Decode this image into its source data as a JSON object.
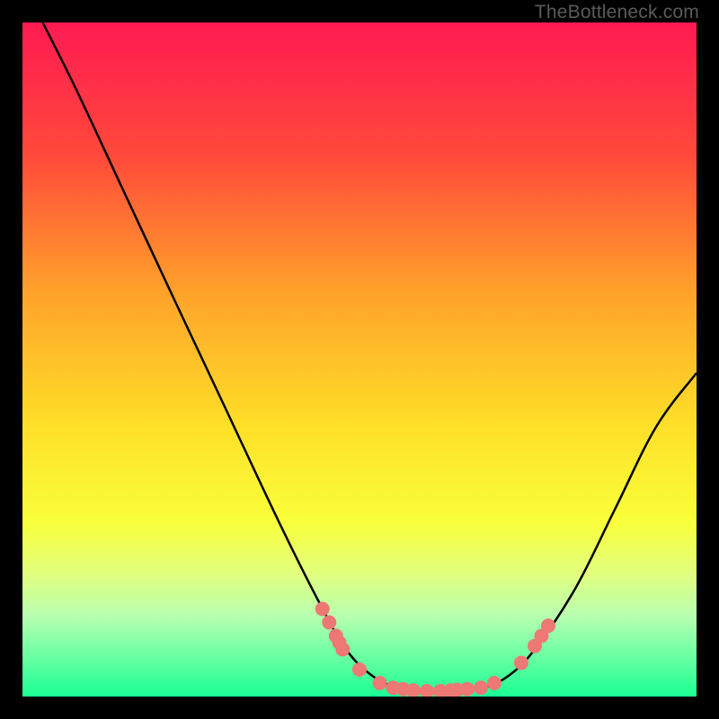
{
  "attribution": "TheBottleneck.com",
  "chart_data": {
    "type": "line",
    "title": "",
    "xlabel": "",
    "ylabel": "",
    "xlim": [
      0,
      100
    ],
    "ylim": [
      0,
      100
    ],
    "gradient_stops": [
      {
        "offset": 0,
        "color": "#ff1a52"
      },
      {
        "offset": 20,
        "color": "#ff4a3a"
      },
      {
        "offset": 40,
        "color": "#ffa22a"
      },
      {
        "offset": 60,
        "color": "#ffe028"
      },
      {
        "offset": 74,
        "color": "#f9ff3a"
      },
      {
        "offset": 82,
        "color": "#e0ff80"
      },
      {
        "offset": 88,
        "color": "#b8ffb0"
      },
      {
        "offset": 95,
        "color": "#5effa0"
      },
      {
        "offset": 100,
        "color": "#1aff94"
      }
    ],
    "curve": [
      {
        "x": 3,
        "y": 100
      },
      {
        "x": 8,
        "y": 90
      },
      {
        "x": 15,
        "y": 75
      },
      {
        "x": 22,
        "y": 60
      },
      {
        "x": 30,
        "y": 43
      },
      {
        "x": 38,
        "y": 26
      },
      {
        "x": 44,
        "y": 14
      },
      {
        "x": 48,
        "y": 7
      },
      {
        "x": 52,
        "y": 3
      },
      {
        "x": 56,
        "y": 1.2
      },
      {
        "x": 60,
        "y": 0.8
      },
      {
        "x": 64,
        "y": 0.8
      },
      {
        "x": 68,
        "y": 1.2
      },
      {
        "x": 72,
        "y": 3
      },
      {
        "x": 76,
        "y": 7
      },
      {
        "x": 82,
        "y": 16
      },
      {
        "x": 88,
        "y": 28
      },
      {
        "x": 94,
        "y": 40
      },
      {
        "x": 100,
        "y": 48
      }
    ],
    "marker_color": "#ed7874",
    "markers": [
      {
        "x": 44.5,
        "y": 13
      },
      {
        "x": 45.5,
        "y": 11
      },
      {
        "x": 46.5,
        "y": 9
      },
      {
        "x": 47,
        "y": 8
      },
      {
        "x": 47.5,
        "y": 7
      },
      {
        "x": 50,
        "y": 4
      },
      {
        "x": 53,
        "y": 2
      },
      {
        "x": 55,
        "y": 1.3
      },
      {
        "x": 56.5,
        "y": 1.1
      },
      {
        "x": 58,
        "y": 0.9
      },
      {
        "x": 60,
        "y": 0.8
      },
      {
        "x": 62,
        "y": 0.8
      },
      {
        "x": 63.5,
        "y": 0.9
      },
      {
        "x": 64.5,
        "y": 1.0
      },
      {
        "x": 66,
        "y": 1.1
      },
      {
        "x": 68,
        "y": 1.3
      },
      {
        "x": 70,
        "y": 2
      },
      {
        "x": 74,
        "y": 5
      },
      {
        "x": 76,
        "y": 7.5
      },
      {
        "x": 77,
        "y": 9
      },
      {
        "x": 78,
        "y": 10.5
      }
    ]
  }
}
